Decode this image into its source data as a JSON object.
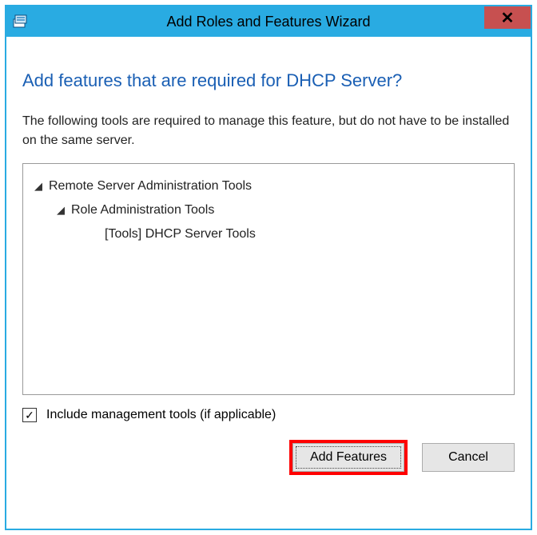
{
  "window": {
    "title": "Add Roles and Features Wizard"
  },
  "heading": "Add features that are required for DHCP Server?",
  "description": "The following tools are required to manage this feature, but do not have to be installed on the same server.",
  "tree": {
    "level0": "Remote Server Administration Tools",
    "level1": "Role Administration Tools",
    "level2": "[Tools] DHCP Server Tools"
  },
  "checkbox": {
    "label": "Include management tools (if applicable)",
    "checked": true
  },
  "buttons": {
    "add": "Add Features",
    "cancel": "Cancel"
  }
}
